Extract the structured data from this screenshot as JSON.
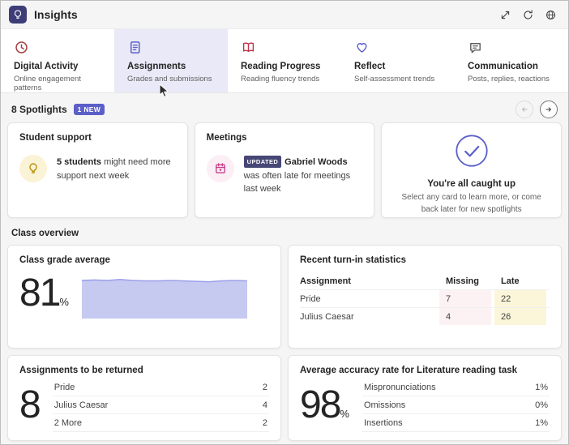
{
  "header": {
    "title": "Insights",
    "icons": [
      "expand-icon",
      "refresh-icon",
      "globe-icon"
    ]
  },
  "tabs": [
    {
      "label": "Digital Activity",
      "sublabel": "Online engagement patterns",
      "selected": false
    },
    {
      "label": "Assignments",
      "sublabel": "Grades and submissions",
      "selected": true
    },
    {
      "label": "Reading Progress",
      "sublabel": "Reading fluency trends",
      "selected": false
    },
    {
      "label": "Reflect",
      "sublabel": "Self-assessment trends",
      "selected": false
    },
    {
      "label": "Communication",
      "sublabel": "Posts, replies, reactions",
      "selected": false
    }
  ],
  "spotlights": {
    "count_label": "8 Spotlights",
    "new_badge": "1 NEW",
    "cards": {
      "student_support": {
        "title": "Student support",
        "highlight": "5 students",
        "rest": " might need more support next week"
      },
      "meetings": {
        "title": "Meetings",
        "badge": "UPDATED",
        "highlight": "Gabriel Woods",
        "rest": " was often late for meetings last week"
      },
      "caught_up": {
        "title": "You're all caught up",
        "subtitle": "Select any card to learn more, or come back later for new spotlights"
      }
    }
  },
  "class_overview": {
    "section_title": "Class overview",
    "grade_average": {
      "title": "Class grade average",
      "value": "81",
      "unit": "%"
    },
    "turn_in": {
      "title": "Recent turn-in statistics",
      "columns": {
        "assignment": "Assignment",
        "missing": "Missing",
        "late": "Late"
      },
      "rows": [
        {
          "name": "Pride",
          "missing": "7",
          "late": "22"
        },
        {
          "name": "Julius Caesar",
          "missing": "4",
          "late": "26"
        }
      ]
    },
    "to_return": {
      "title": "Assignments to be returned",
      "value": "8",
      "rows": [
        {
          "name": "Pride",
          "count": "2"
        },
        {
          "name": "Julius Caesar",
          "count": "4"
        },
        {
          "name": "2 More",
          "count": "2"
        }
      ]
    },
    "accuracy": {
      "title": "Average accuracy rate for Literature reading task",
      "value": "98",
      "unit": "%",
      "rows": [
        {
          "name": "Mispronunciations",
          "value": "1%"
        },
        {
          "name": "Omissions",
          "value": "0%"
        },
        {
          "name": "Insertions",
          "value": "1%"
        }
      ]
    }
  },
  "chart_data": {
    "type": "area",
    "title": "Class grade average trend",
    "values": [
      84,
      85,
      84,
      86,
      84,
      83,
      83,
      84,
      83,
      82,
      81,
      83,
      84,
      83
    ],
    "ylim": [
      0,
      100
    ],
    "grid": false,
    "legend": false
  },
  "colors": {
    "accent": "#5b5fc7",
    "badge_dark": "#464775",
    "chart_fill": "#c6c9f0",
    "chart_line": "#9aa0e8",
    "missing_bg": "#fcf2f4",
    "late_bg": "#fbf6d9"
  }
}
